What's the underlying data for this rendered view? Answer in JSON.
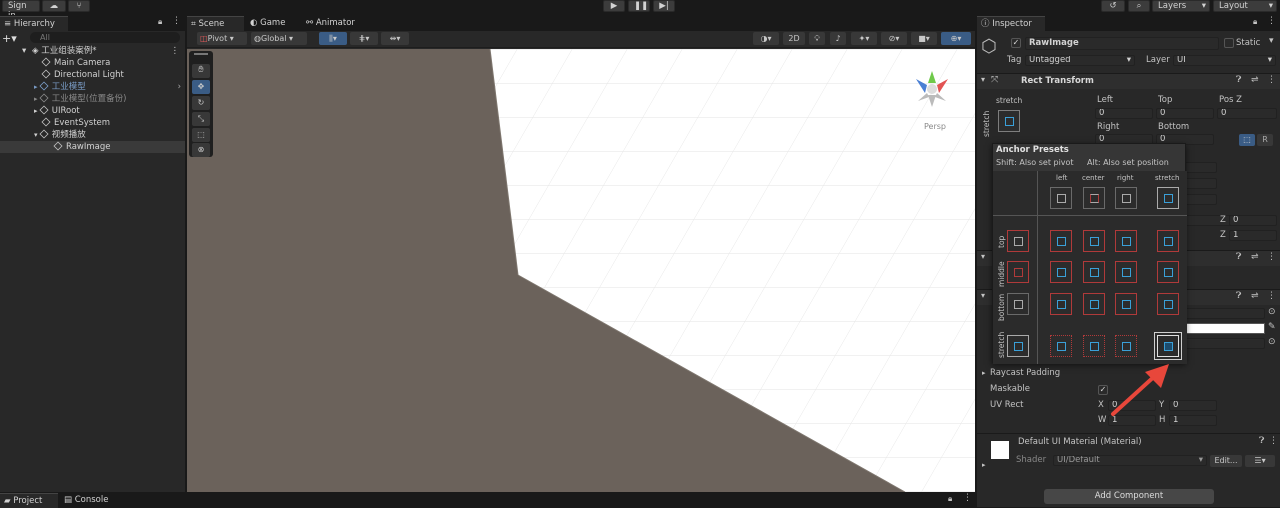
{
  "topbar": {
    "sign_in": "Sign in",
    "layers": "Layers",
    "layout": "Layout"
  },
  "hierarchy": {
    "tab": "Hierarchy",
    "search_placeholder": "All",
    "scene": "工业组装案例*",
    "items": [
      "Main Camera",
      "Directional Light",
      "工业模型",
      "工业模型(位置备份)",
      "UIRoot",
      "EventSystem",
      "视频播放",
      "RawImage"
    ]
  },
  "scene_view": {
    "tabs": [
      "Scene",
      "Game",
      "Animator"
    ],
    "pivot": "Pivot",
    "global": "Global",
    "mode_2d": "2D",
    "persp": "Persp"
  },
  "inspector": {
    "tab": "Inspector",
    "object_name": "RawImage",
    "static_label": "Static",
    "tag_label": "Tag",
    "tag_value": "Untagged",
    "layer_label": "Layer",
    "layer_value": "UI",
    "rect_transform": "Rect Transform",
    "stretch": "stretch",
    "left_label": "Left",
    "top_label": "Top",
    "posz_label": "Pos Z",
    "left": "0",
    "top": "0",
    "posz": "0",
    "right_label": "Right",
    "bottom_label": "Bottom",
    "right": "0",
    "bottom": "0",
    "r_button": "R",
    "z_label": "Z",
    "z_rot": "0",
    "z_scale": "1",
    "raycast_padding": "Raycast Padding",
    "maskable": "Maskable",
    "uv_rect": "UV Rect",
    "uv_x_label": "X",
    "uv_x": "0",
    "uv_y_label": "Y",
    "uv_y": "0",
    "uv_w_label": "W",
    "uv_w": "1",
    "uv_h_label": "H",
    "uv_h": "1",
    "material": "Default UI Material (Material)",
    "shader_label": "Shader",
    "shader": "UI/Default",
    "edit": "Edit...",
    "add_component": "Add Component"
  },
  "anchor_presets": {
    "title": "Anchor Presets",
    "shift_hint": "Shift: Also set pivot",
    "alt_hint": "Alt: Also set position",
    "columns": [
      "left",
      "center",
      "right",
      "stretch"
    ],
    "rows": [
      "top",
      "middle",
      "bottom",
      "stretch"
    ]
  },
  "bottom_tabs": [
    "Project",
    "Console"
  ],
  "colors": {
    "accent": "#3a5c85",
    "arrow": "#e8473b",
    "scene_ground": "#6b625b"
  }
}
